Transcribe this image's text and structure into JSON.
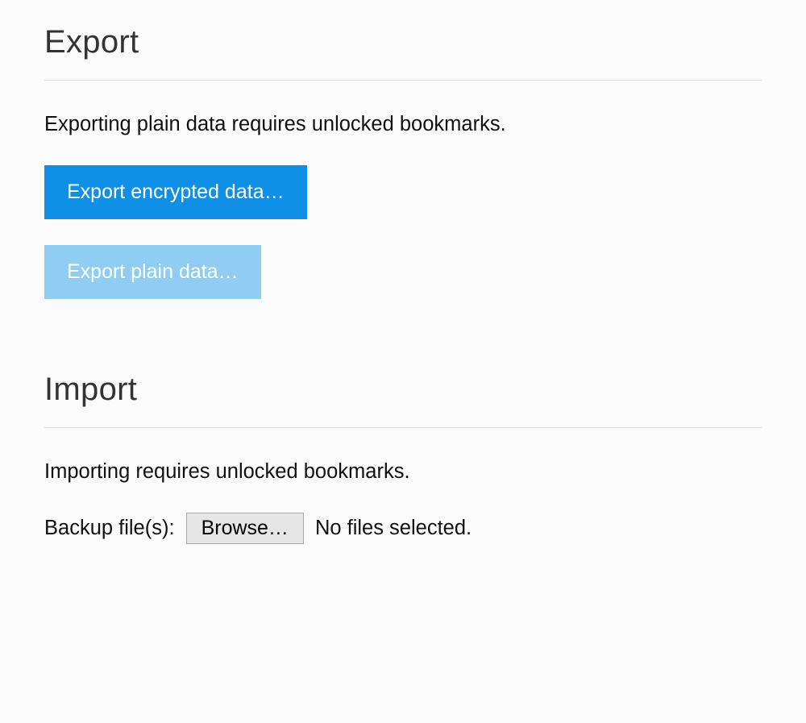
{
  "export": {
    "heading": "Export",
    "description": "Exporting plain data requires unlocked bookmarks.",
    "buttons": {
      "encrypted": "Export encrypted data…",
      "plain": "Export plain data…"
    }
  },
  "import": {
    "heading": "Import",
    "description": "Importing requires unlocked bookmarks.",
    "backup_label": "Backup file(s):",
    "browse_label": "Browse…",
    "file_status": "No files selected."
  }
}
